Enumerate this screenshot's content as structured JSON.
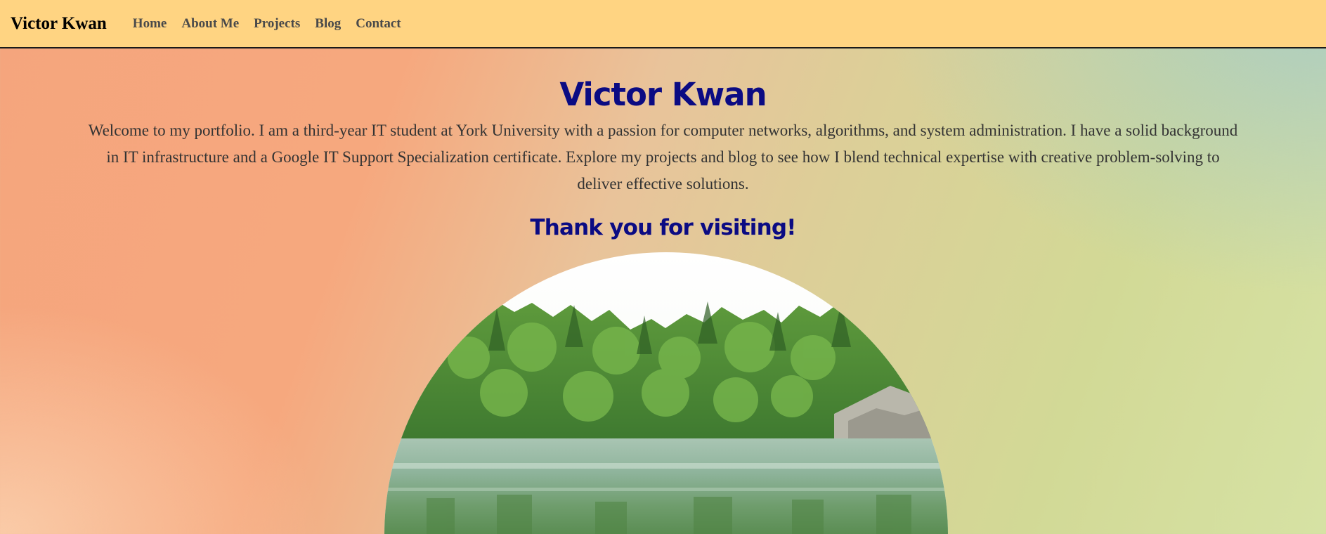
{
  "nav": {
    "brand": "Victor Kwan",
    "links": [
      "Home",
      "About Me",
      "Projects",
      "Blog",
      "Contact"
    ]
  },
  "main": {
    "title": "Victor Kwan",
    "intro": "Welcome to my portfolio. I am a third-year IT student at York University with a passion for computer networks, algorithms, and system administration. I have a solid background in IT infrastructure and a Google IT Support Specialization certificate. Explore my projects and blog to see how I blend technical expertise with creative problem-solving to deliver effective solutions.",
    "thanks": "Thank you for visiting!"
  },
  "colors": {
    "navbar": "#ffd482",
    "heading": "#0b0b83",
    "text": "#333333"
  }
}
